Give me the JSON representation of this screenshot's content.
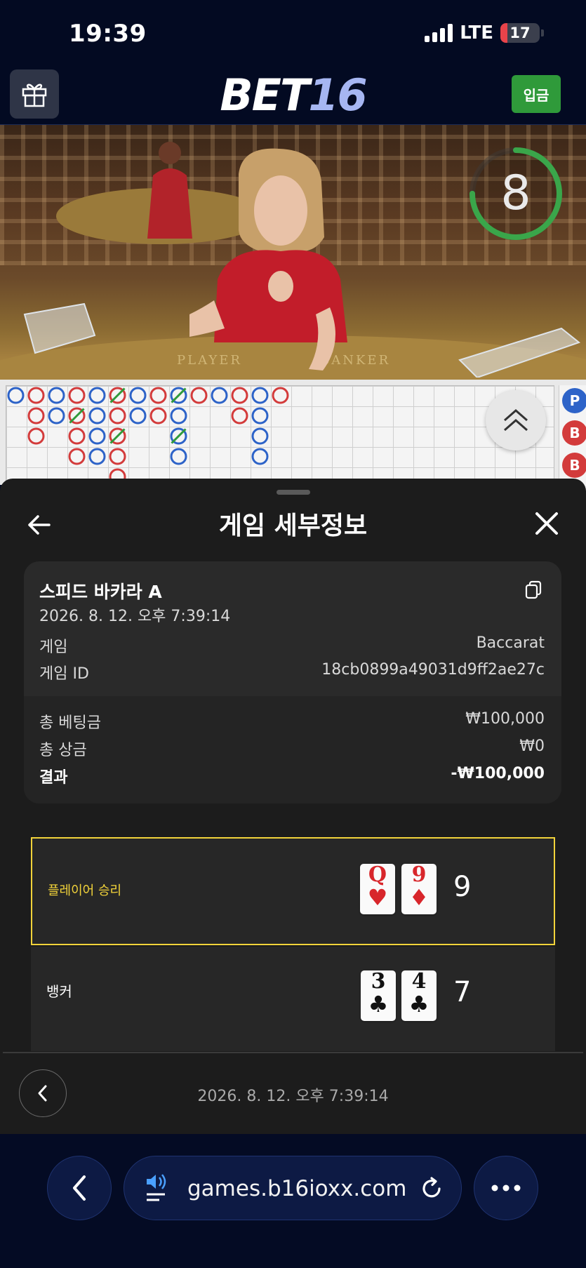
{
  "status_bar": {
    "time": "19:39",
    "network": "LTE",
    "battery": "17",
    "battery_level": 0.17
  },
  "header": {
    "logo_part1": "BET",
    "logo_part2": "16",
    "deposit_label": "입금"
  },
  "video": {
    "countdown": "8",
    "countdown_progress": 0.75,
    "felt_player": "PLAYER",
    "felt_banker": "BANKER"
  },
  "roadmap": {
    "side_markers": [
      "P",
      "B",
      "B"
    ]
  },
  "sheet": {
    "title": "게임 세부정보",
    "game_name": "스피드 바카라 A",
    "game_datetime": "2026. 8. 12. 오후 7:39:14",
    "details": [
      {
        "label": "게임",
        "value": "Baccarat"
      },
      {
        "label": "게임 ID",
        "value": "18cb0899a49031d9ff2ae27c"
      }
    ],
    "totals": [
      {
        "label": "총 베팅금",
        "value": "₩100,000"
      },
      {
        "label": "총 상금",
        "value": "₩0"
      },
      {
        "label": "결과",
        "value": "-₩100,000"
      }
    ],
    "player": {
      "label": "플레이어 승리",
      "cards": [
        {
          "rank": "Q",
          "suit": "♥",
          "color": "#d8262b"
        },
        {
          "rank": "9",
          "suit": "♦",
          "color": "#d8262b"
        }
      ],
      "score": "9"
    },
    "banker": {
      "label": "뱅커",
      "cards": [
        {
          "rank": "3",
          "suit": "♣",
          "color": "#111111"
        },
        {
          "rank": "4",
          "suit": "♣",
          "color": "#111111"
        }
      ],
      "score": "7"
    },
    "footer_datetime": "2026. 8. 12. 오후 7:39:14"
  },
  "browser": {
    "url": "games.b16ioxx.com"
  },
  "colors": {
    "player_blue": "#2d63c8",
    "banker_red": "#d33b3b",
    "tie_green": "#2f9a3a",
    "highlight_yellow": "#f2d33a"
  }
}
